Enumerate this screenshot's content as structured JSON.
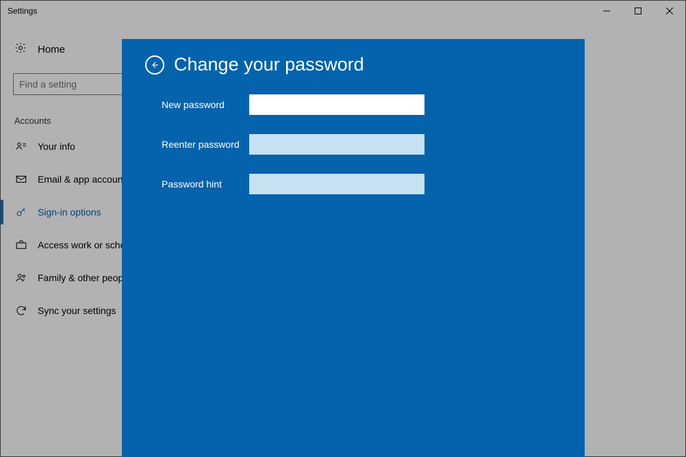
{
  "titlebar": {
    "title": "Settings"
  },
  "sidebar": {
    "home_label": "Home",
    "search_placeholder": "Find a setting",
    "section_label": "Accounts",
    "items": [
      {
        "label": "Your info"
      },
      {
        "label": "Email & app accounts"
      },
      {
        "label": "Sign-in options"
      },
      {
        "label": "Access work or school"
      },
      {
        "label": "Family & other people"
      },
      {
        "label": "Sync your settings"
      }
    ]
  },
  "modal": {
    "title": "Change your password",
    "fields": {
      "new_password_label": "New password",
      "reenter_password_label": "Reenter password",
      "password_hint_label": "Password hint",
      "new_password_value": "",
      "reenter_password_value": "",
      "password_hint_value": ""
    }
  }
}
